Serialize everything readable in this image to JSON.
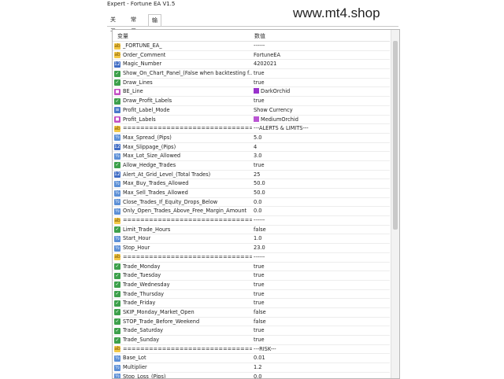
{
  "window": {
    "title": "Expert - Fortune EA V1.5"
  },
  "watermark": "www.mt4.shop",
  "tabs": [
    "关于",
    "常用",
    "输入参数"
  ],
  "table": {
    "headers": [
      "变量",
      "数值"
    ],
    "rows": [
      {
        "icon": "ab",
        "name": "_FORTUNE_EA_",
        "value": "------"
      },
      {
        "icon": "ab",
        "name": "Order_Comment",
        "value": "FortuneEA"
      },
      {
        "icon": "int",
        "name": "Magic_Number",
        "value": "4202021"
      },
      {
        "icon": "bool",
        "name": "Show_On_Chart_Panel_(False when backtesting f...",
        "value": "true"
      },
      {
        "icon": "bool",
        "name": "Draw_Lines",
        "value": "true"
      },
      {
        "icon": "color",
        "name": "BE_Line",
        "value": "DarkOrchid",
        "swatch": "#9932cc"
      },
      {
        "icon": "bool",
        "name": "Draw_Profit_Labels",
        "value": "true"
      },
      {
        "icon": "enum",
        "name": "Profit_Label_Mode",
        "value": "Show Currency"
      },
      {
        "icon": "color",
        "name": "Profit_Labels",
        "value": "MediumOrchid",
        "swatch": "#ba55d3"
      },
      {
        "icon": "ab",
        "name": "==================================",
        "value": "---ALERTS & LIMITS---"
      },
      {
        "icon": "num",
        "name": "Max_Spread_(Pips)",
        "value": "5.0"
      },
      {
        "icon": "int",
        "name": "Max_Slippage_(Pips)",
        "value": "4"
      },
      {
        "icon": "num",
        "name": "Max_Lot_Size_Allowed",
        "value": "3.0"
      },
      {
        "icon": "bool",
        "name": "Allow_Hedge_Trades",
        "value": "true"
      },
      {
        "icon": "int",
        "name": "Alert_At_Grid_Level_(Total Trades)",
        "value": "25"
      },
      {
        "icon": "num",
        "name": "Max_Buy_Trades_Allowed",
        "value": "50.0"
      },
      {
        "icon": "num",
        "name": "Max_Sell_Trades_Allowed",
        "value": "50.0"
      },
      {
        "icon": "num",
        "name": "Close_Trades_If_Equity_Drops_Below",
        "value": "0.0"
      },
      {
        "icon": "num",
        "name": "Only_Open_Trades_Above_Free_Margin_Amount",
        "value": "0.0"
      },
      {
        "icon": "ab",
        "name": "==================================",
        "value": "------"
      },
      {
        "icon": "bool",
        "name": "Limit_Trade_Hours",
        "value": "false"
      },
      {
        "icon": "num",
        "name": "Start_Hour",
        "value": "1.0"
      },
      {
        "icon": "num",
        "name": "Stop_Hour",
        "value": "23.0"
      },
      {
        "icon": "ab",
        "name": "==================================",
        "value": "------"
      },
      {
        "icon": "bool",
        "name": "Trade_Monday",
        "value": "true"
      },
      {
        "icon": "bool",
        "name": "Trade_Tuesday",
        "value": "true"
      },
      {
        "icon": "bool",
        "name": "Trade_Wednesday",
        "value": "true"
      },
      {
        "icon": "bool",
        "name": "Trade_Thursday",
        "value": "true"
      },
      {
        "icon": "bool",
        "name": "Trade_Friday",
        "value": "true"
      },
      {
        "icon": "bool",
        "name": "SKIP_Monday_Market_Open",
        "value": "false"
      },
      {
        "icon": "bool",
        "name": "STOP_Trade_Before_Weekend",
        "value": "false"
      },
      {
        "icon": "bool",
        "name": "Trade_Saturday",
        "value": "true"
      },
      {
        "icon": "bool",
        "name": "Trade_Sunday",
        "value": "true"
      },
      {
        "icon": "ab",
        "name": "==================================",
        "value": "---RISK---"
      },
      {
        "icon": "num",
        "name": "Base_Lot",
        "value": "0.01"
      },
      {
        "icon": "num",
        "name": "Multiplier",
        "value": "1.2"
      },
      {
        "icon": "num",
        "name": "Stop_Loss_(Pips)",
        "value": "0.0"
      }
    ]
  },
  "icon_glyphs": {
    "ab": "ab",
    "num": "½",
    "int": "123",
    "bool": "✓",
    "color": "◼",
    "enum": "≡"
  }
}
